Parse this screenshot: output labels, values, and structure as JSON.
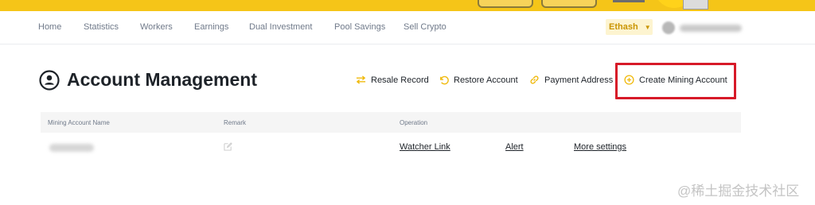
{
  "nav": {
    "items": [
      {
        "label": "Home"
      },
      {
        "label": "Statistics"
      },
      {
        "label": "Workers"
      },
      {
        "label": "Earnings"
      },
      {
        "label": "Dual Investment"
      },
      {
        "label": "Pool Savings"
      },
      {
        "label": "Sell Crypto"
      }
    ],
    "algorithm": "Ethash"
  },
  "page": {
    "title": "Account Management"
  },
  "actions": {
    "resale_record": "Resale Record",
    "restore_account": "Restore Account",
    "payment_address": "Payment Address",
    "create_mining_account": "Create Mining Account"
  },
  "table": {
    "headers": [
      "Mining Account Name",
      "Remark",
      "Operation"
    ],
    "rows": [
      {
        "watcher_link": "Watcher Link",
        "alert": "Alert",
        "more_settings": "More settings"
      }
    ]
  },
  "watermark": "@稀土掘金技术社区",
  "colors": {
    "brand_yellow": "#f5c518",
    "accent_gold": "#f0b90b",
    "highlight_red": "#d71a28"
  }
}
